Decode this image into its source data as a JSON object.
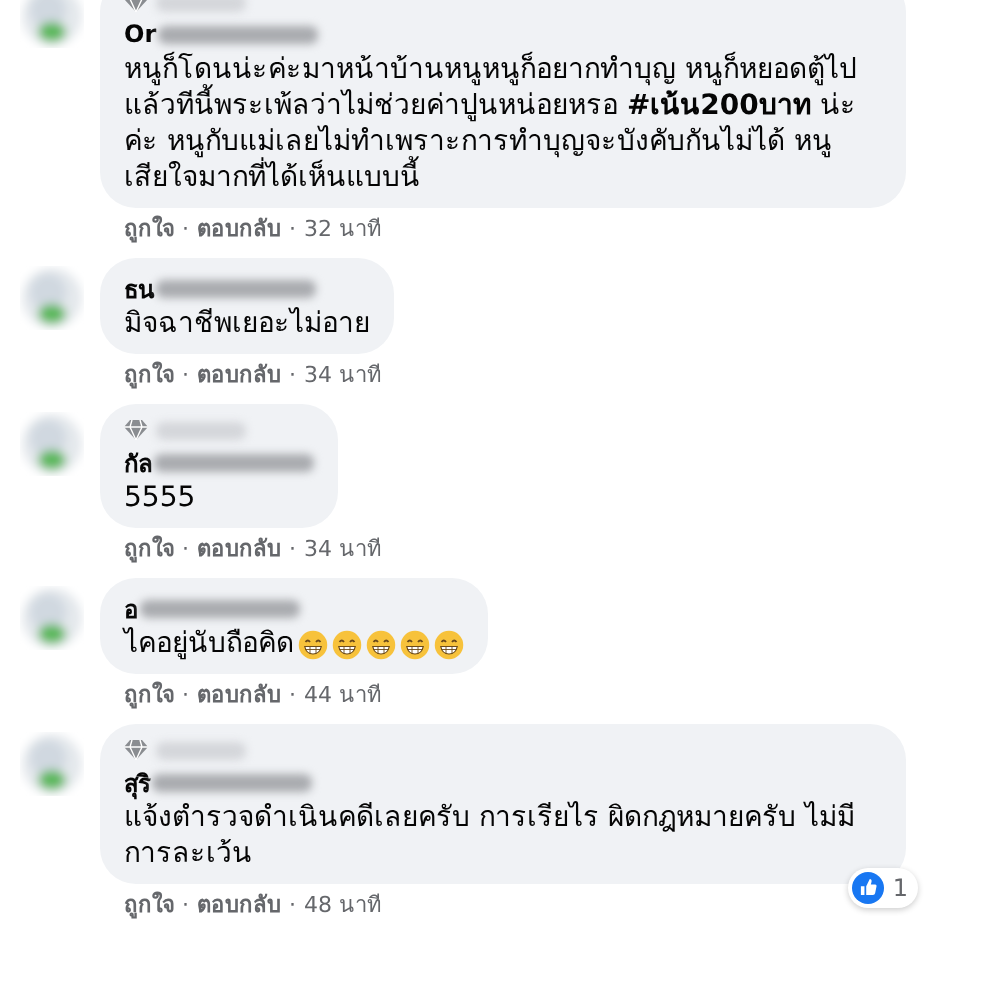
{
  "comments": [
    {
      "badge": true,
      "name": "Or",
      "text": "หนูก็โดนน่ะค่ะมาหน้าบ้านหนูหนูก็อยากทำบุญ หนูก็หยอดตู้ไป แล้วทีนี้พระเพ้ลว่าไม่ช่วยค่าปูนหน่อยหรอ **#เน้น200บาท** น่ะค่ะ หนูกับแม่เลยไม่ทำเพราะการทำบุญจะบังคับกันไม่ได้ หนูเสียใจมากที่ได้เห็นแบบนี้",
      "like": "ถูกใจ",
      "sep1": "·",
      "reply": "ตอบกลับ",
      "sep2": "·",
      "time": "32 นาที"
    },
    {
      "badge": false,
      "name": "ธน",
      "text": "มิจฉาชีพเยอะไม่อาย",
      "like": "ถูกใจ",
      "sep1": "·",
      "reply": "ตอบกลับ",
      "sep2": "·",
      "time": "34 นาที"
    },
    {
      "badge": true,
      "name": "กัล",
      "text": "5555",
      "like": "ถูกใจ",
      "sep1": "·",
      "reply": "ตอบกลับ",
      "sep2": "·",
      "time": "34 นาที"
    },
    {
      "badge": false,
      "name": "อ",
      "text": "ไคอยู่นับถือคิด",
      "emojis": [
        {
          "kind": "grin"
        },
        {
          "kind": "grin"
        },
        {
          "kind": "grin"
        },
        {
          "kind": "grin"
        },
        {
          "kind": "grin"
        }
      ],
      "like": "ถูกใจ",
      "sep1": "·",
      "reply": "ตอบกลับ",
      "sep2": "·",
      "time": "44 นาที"
    },
    {
      "badge": true,
      "name": "สุริ",
      "text": "แจ้งตำรวจดำเนินคดีเลยครับ การเรียไร ผิดกฎหมายครับ ไม่มีการละเว้น",
      "reaction_count": "1",
      "like": "ถูกใจ",
      "sep1": "·",
      "reply": "ตอบกลับ",
      "sep2": "·",
      "time": "48 นาที"
    }
  ]
}
